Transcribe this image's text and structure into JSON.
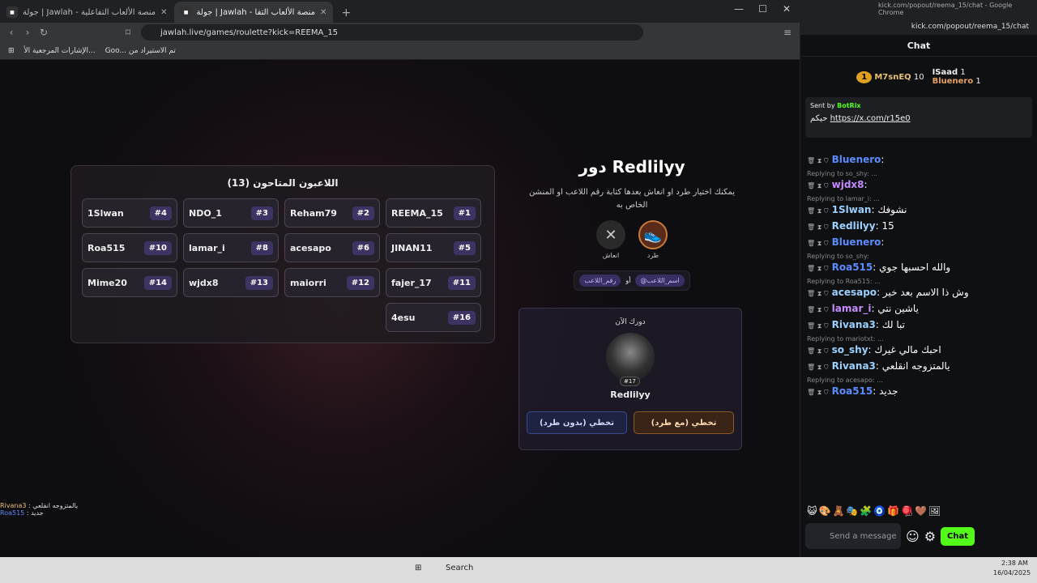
{
  "left_window": {
    "tabs": [
      {
        "label": "جولة | Jawlah - منصة الألعاب التفاعلية",
        "active": false
      },
      {
        "label": "جولة | Jawlah - منصة الألعاب التفا",
        "active": true
      }
    ],
    "url": "jawlah.live/games/roulette?kick=REEMA_15",
    "bookmarks": [
      "الإشارات المرجعية الأ...",
      "Goo... تم الاستيراد من"
    ]
  },
  "game": {
    "panel_title": "اللاعبون المتاحون (13)",
    "players": [
      {
        "name": "1Slwan",
        "num": "#4"
      },
      {
        "name": "NDO_1",
        "num": "#3"
      },
      {
        "name": "Reham79",
        "num": "#2"
      },
      {
        "name": "REEMA_15",
        "num": "#1"
      },
      {
        "name": "Roa515",
        "num": "#10"
      },
      {
        "name": "lamar_i",
        "num": "#8"
      },
      {
        "name": "acesapo",
        "num": "#6"
      },
      {
        "name": "JINAN11",
        "num": "#5"
      },
      {
        "name": "Mime20",
        "num": "#14"
      },
      {
        "name": "wjdx8",
        "num": "#13"
      },
      {
        "name": "maiorri",
        "num": "#12"
      },
      {
        "name": "fajer_17",
        "num": "#11"
      },
      {
        "name": "",
        "num": ""
      },
      {
        "name": "",
        "num": ""
      },
      {
        "name": "",
        "num": ""
      },
      {
        "name": "4esu",
        "num": "#16"
      }
    ],
    "turn_title": "دور Redlilyy",
    "turn_desc": "يمكنك اختيار طرد او انعاش بعدها كتابة رقم اللاعب او المنشن الخاص به",
    "kick_label": "طرد",
    "revive_label": "انعاش",
    "tag_name": "@اسم_اللاعب",
    "tag_or": "أو",
    "tag_num": "رقم_اللاعب",
    "now_label": "دورك الآن",
    "now_num": "#17",
    "now_name": "Redlilyy",
    "btn_with": "تخطي (مع طرد)",
    "btn_without": "تخطي (بدون طرد)"
  },
  "overlay": [
    {
      "user": "Rivana3",
      "text": ": يالمتزوجه انقلعي"
    },
    {
      "user": "Roa515",
      "text": ": جديد"
    }
  ],
  "taskbar": {
    "search": "Search",
    "time": "2:38 AM",
    "date": "16/04/2025"
  },
  "right_window": {
    "title": "kick.com/popout/reema_15/chat - Google Chrome",
    "address": "kick.com/popout/reema_15/chat",
    "chat_header": "Chat",
    "leaders": [
      {
        "name": "M7snEQ",
        "count": "10"
      },
      {
        "name": "ISaad",
        "count": "1"
      },
      {
        "name": "Bluenero",
        "count": "1"
      }
    ],
    "pinned": {
      "sent_by": "Sent by",
      "bot": "BotRix",
      "link": "https://x.com/r15e0",
      "prefix": "حيكم"
    },
    "messages": [
      {
        "reply": "",
        "user": "Bluenero",
        "color": "#5b8cff",
        "text": ""
      },
      {
        "reply": "Replying to so_shy: ...",
        "user": "wjdx8",
        "color": "#c58aff",
        "text": ""
      },
      {
        "reply": "Replying to lamar_i: ...",
        "user": "1Slwan",
        "color": "#9ad1ff",
        "text": "نشوفك"
      },
      {
        "reply": "",
        "user": "Redlilyy",
        "color": "#9ad1ff",
        "text": "15"
      },
      {
        "reply": "",
        "user": "Bluenero",
        "color": "#5b8cff",
        "text": ""
      },
      {
        "reply": "Replying to so_shy:",
        "user": "Roa515",
        "color": "#5b8cff",
        "text": "والله احسبها جوي"
      },
      {
        "reply": "Replying to Roa515: ...",
        "user": "acesapo",
        "color": "#9ad1ff",
        "text": "وش ذا الاسم بعد خير"
      },
      {
        "reply": "",
        "user": "lamar_i",
        "color": "#c58aff",
        "text": "ياشين نتي"
      },
      {
        "reply": "",
        "user": "Rivana3",
        "color": "#9ad1ff",
        "text": "تبا لك"
      },
      {
        "reply": "Replying to mariotxt: ...",
        "user": "so_shy",
        "color": "#9ad1ff",
        "text": "احبك مالي غيرك"
      },
      {
        "reply": "",
        "user": "Rivana3",
        "color": "#9ad1ff",
        "text": "يالمتزوجه انقلعي"
      },
      {
        "reply": "Replying to acesapo: ...",
        "user": "Roa515",
        "color": "#5b8cff",
        "text": "جديد"
      }
    ],
    "input_placeholder": "Send a message",
    "chat_button": "Chat"
  }
}
